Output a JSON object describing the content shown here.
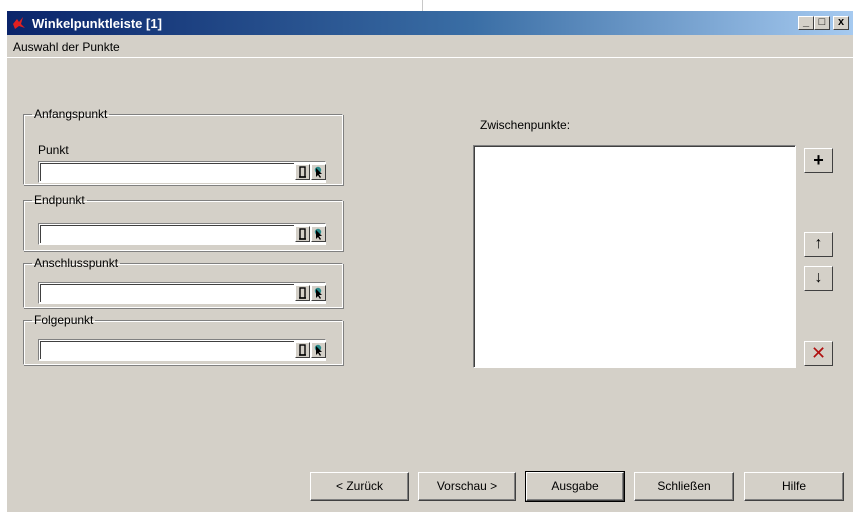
{
  "window": {
    "title": "Winkelpunktleiste [1]",
    "controls": {
      "minimize": "_",
      "maximize": "□",
      "close": "x"
    }
  },
  "menu": {
    "tab": "Auswahl der Punkte"
  },
  "groups": {
    "anfangspunkt": {
      "legend": "Anfangspunkt",
      "sublabel": "Punkt",
      "value": ""
    },
    "endpunkt": {
      "legend": "Endpunkt",
      "value": ""
    },
    "anschlusspunkt": {
      "legend": "Anschlusspunkt",
      "value": ""
    },
    "folgepunkt": {
      "legend": "Folgepunkt",
      "value": ""
    }
  },
  "zwischenpunkte": {
    "label": "Zwischenpunkte:",
    "items": [],
    "buttons": {
      "add": "+",
      "up": "↑",
      "down": "↓",
      "delete": "✕"
    }
  },
  "footer": {
    "back": "< Zurück",
    "preview": "Vorschau >",
    "output": "Ausgabe",
    "close": "Schließen",
    "help": "Hilfe"
  },
  "colors": {
    "dialog_bg": "#d4d0c8",
    "titlebar_start": "#0a246a",
    "titlebar_end": "#a6caf0",
    "delete_icon": "#b01010"
  }
}
